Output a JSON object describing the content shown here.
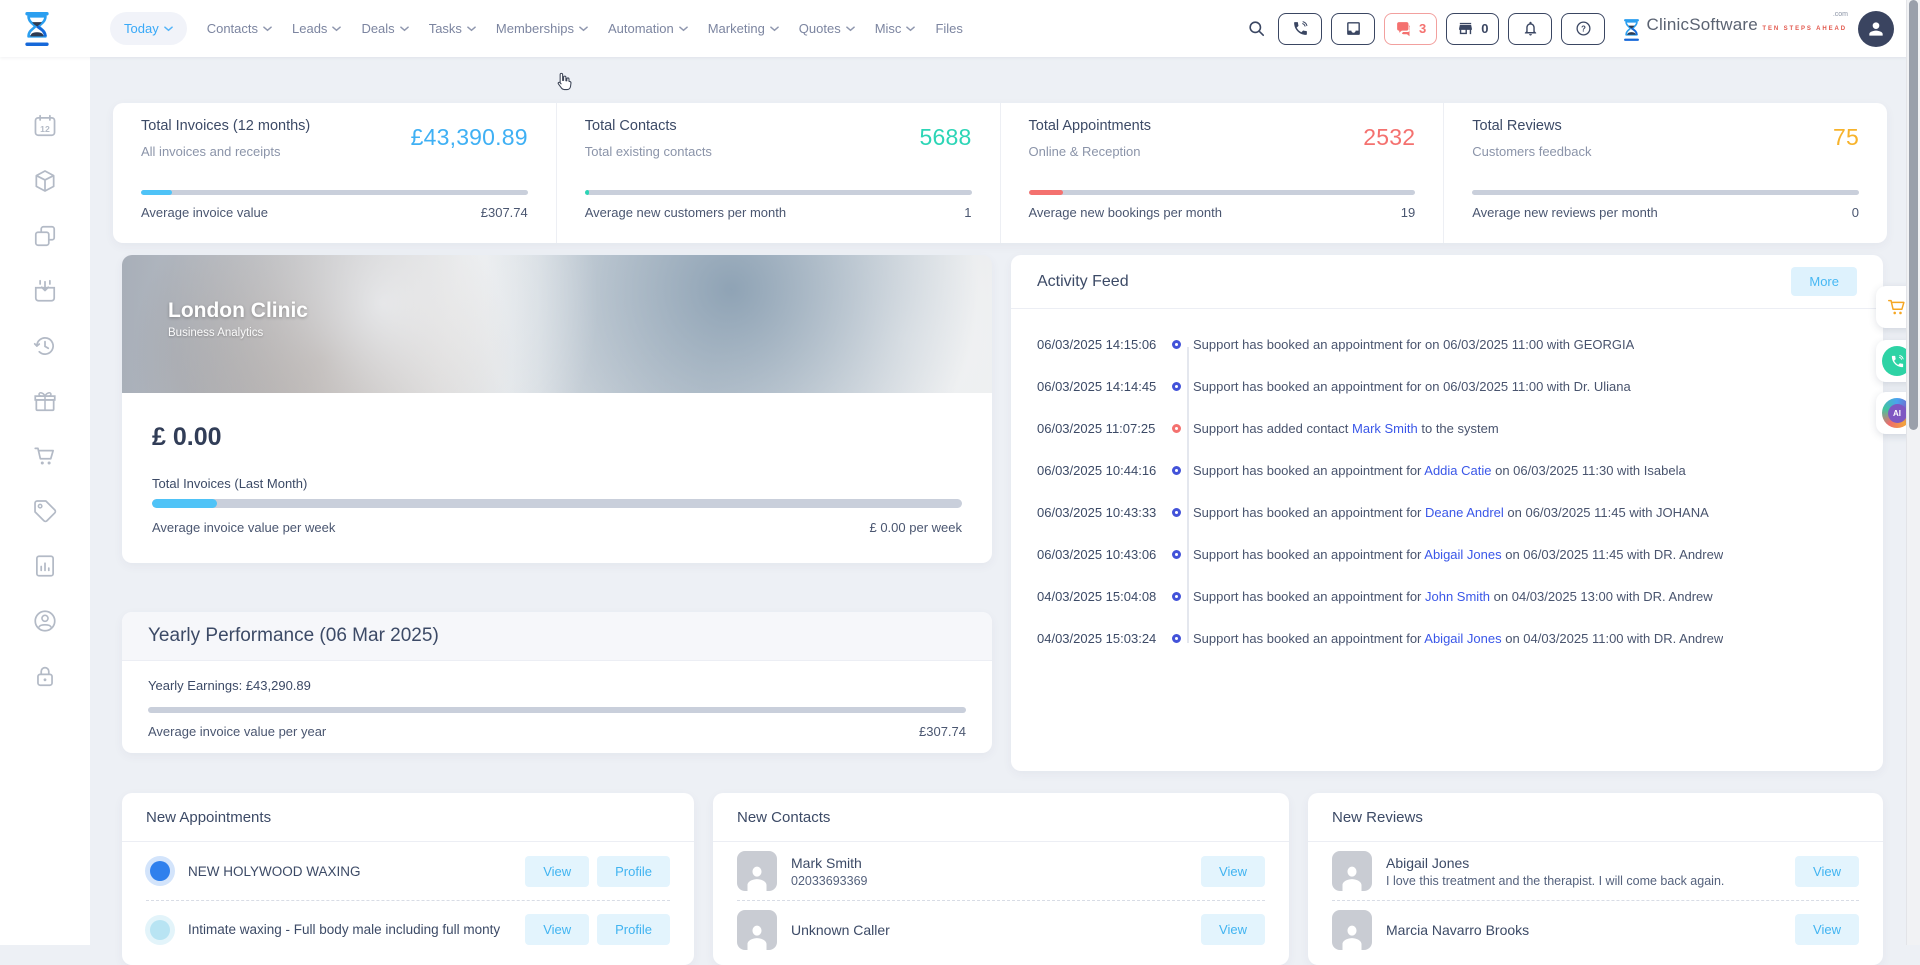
{
  "header": {
    "nav": [
      {
        "label": "Today",
        "active": true,
        "chevron": true
      },
      {
        "label": "Contacts",
        "active": false,
        "chevron": true
      },
      {
        "label": "Leads",
        "active": false,
        "chevron": true
      },
      {
        "label": "Deals",
        "active": false,
        "chevron": true
      },
      {
        "label": "Tasks",
        "active": false,
        "chevron": true
      },
      {
        "label": "Memberships",
        "active": false,
        "chevron": true
      },
      {
        "label": "Automation",
        "active": false,
        "chevron": true
      },
      {
        "label": "Marketing",
        "active": false,
        "chevron": true
      },
      {
        "label": "Quotes",
        "active": false,
        "chevron": true
      },
      {
        "label": "Misc",
        "active": false,
        "chevron": true
      },
      {
        "label": "Files",
        "active": false,
        "chevron": false
      }
    ],
    "chat_count": "3",
    "store_count": "0",
    "brand": {
      "name": "ClinicSoftware",
      "tld": ".com",
      "tagline": "TEN STEPS AHEAD"
    }
  },
  "sidebar": {
    "icons": [
      "calendar-12",
      "package",
      "copy",
      "calendar-import",
      "history",
      "gift",
      "cart",
      "price-tag",
      "report",
      "user-badge",
      "lock"
    ]
  },
  "stats": [
    {
      "title": "Total Invoices (12 months)",
      "subtitle": "All invoices and receipts",
      "value": "£43,390.89",
      "value_color": "#3fb0f4",
      "progress_pct": 8,
      "progress_color": "#4fc3f7",
      "footer_label": "Average invoice value",
      "footer_value": "£307.74"
    },
    {
      "title": "Total Contacts",
      "subtitle": "Total existing contacts",
      "value": "5688",
      "value_color": "#2cd5b6",
      "progress_pct": 1,
      "progress_color": "#2cd5b6",
      "footer_label": "Average new customers per month",
      "footer_value": "1"
    },
    {
      "title": "Total Appointments",
      "subtitle": "Online & Reception",
      "value": "2532",
      "value_color": "#f4716f",
      "progress_pct": 9,
      "progress_color": "#f4716f",
      "footer_label": "Average new bookings per month",
      "footer_value": "19"
    },
    {
      "title": "Total Reviews",
      "subtitle": "Customers feedback",
      "value": "75",
      "value_color": "#f7b32b",
      "progress_pct": 0,
      "progress_color": "#f7b32b",
      "footer_label": "Average new reviews per month",
      "footer_value": "0"
    }
  ],
  "clinic": {
    "title": "London Clinic",
    "subtitle": "Business Analytics",
    "amount": "£ 0.00",
    "metric_label": "Total Invoices (Last Month)",
    "progress_pct": 8,
    "footer_label": "Average invoice value per week",
    "footer_value": "£ 0.00 per week"
  },
  "yearly": {
    "title": "Yearly Performance (06 Mar 2025)",
    "earnings_label": "Yearly Earnings:",
    "earnings_value": "£43,290.89",
    "footer_label": "Average invoice value per year",
    "footer_value": "£307.74"
  },
  "activity": {
    "title": "Activity Feed",
    "more_label": "More",
    "items": [
      {
        "ts": "06/03/2025 14:15:06",
        "color": "blue",
        "pre": "Support has booked an appointment for on 06/03/2025 11:00 with GEORGIA",
        "link": "",
        "post": ""
      },
      {
        "ts": "06/03/2025 14:14:45",
        "color": "blue",
        "pre": "Support has booked an appointment for on 06/03/2025 11:00 with Dr. Uliana",
        "link": "",
        "post": ""
      },
      {
        "ts": "06/03/2025 11:07:25",
        "color": "red",
        "pre": "Support has added contact ",
        "link": "Mark Smith",
        "post": " to the system"
      },
      {
        "ts": "06/03/2025 10:44:16",
        "color": "blue",
        "pre": "Support has booked an appointment for ",
        "link": "Addia Catie",
        "post": " on 06/03/2025 11:30 with Isabela"
      },
      {
        "ts": "06/03/2025 10:43:33",
        "color": "blue",
        "pre": "Support has booked an appointment for ",
        "link": "Deane Andrel",
        "post": " on 06/03/2025 11:45 with JOHANA"
      },
      {
        "ts": "06/03/2025 10:43:06",
        "color": "blue",
        "pre": "Support has booked an appointment for ",
        "link": "Abigail Jones",
        "post": " on 06/03/2025 11:45 with DR. Andrew"
      },
      {
        "ts": "04/03/2025 15:04:08",
        "color": "blue",
        "pre": "Support has booked an appointment for ",
        "link": "John Smith",
        "post": " on 04/03/2025 13:00 with DR. Andrew"
      },
      {
        "ts": "04/03/2025 15:03:24",
        "color": "blue",
        "pre": "Support has booked an appointment for ",
        "link": "Abigail Jones",
        "post": " on 04/03/2025 11:00 with DR. Andrew"
      }
    ]
  },
  "bottom": {
    "appointments": {
      "title": "New Appointments",
      "rows": [
        {
          "dot_color": "#2f80ed",
          "dot_ring": "#d3e4fb",
          "label": "NEW HOLYWOOD WAXING",
          "actions": [
            "View",
            "Profile"
          ]
        },
        {
          "dot_color": "#b8e4f3",
          "dot_ring": "#e3f4fa",
          "label": "Intimate waxing - Full body male including full monty",
          "actions": [
            "View",
            "Profile"
          ]
        }
      ]
    },
    "contacts": {
      "title": "New Contacts",
      "rows": [
        {
          "name": "Mark Smith",
          "sub": "02033693369",
          "actions": [
            "View"
          ]
        },
        {
          "name": "Unknown Caller",
          "sub": "",
          "actions": [
            "View"
          ]
        }
      ]
    },
    "reviews": {
      "title": "New Reviews",
      "rows": [
        {
          "name": "Abigail Jones",
          "sub": "I love this treatment and the therapist. I will come back again.",
          "actions": [
            "View"
          ]
        },
        {
          "name": "Marcia Navarro Brooks",
          "sub": "",
          "actions": [
            "View"
          ]
        }
      ]
    }
  }
}
